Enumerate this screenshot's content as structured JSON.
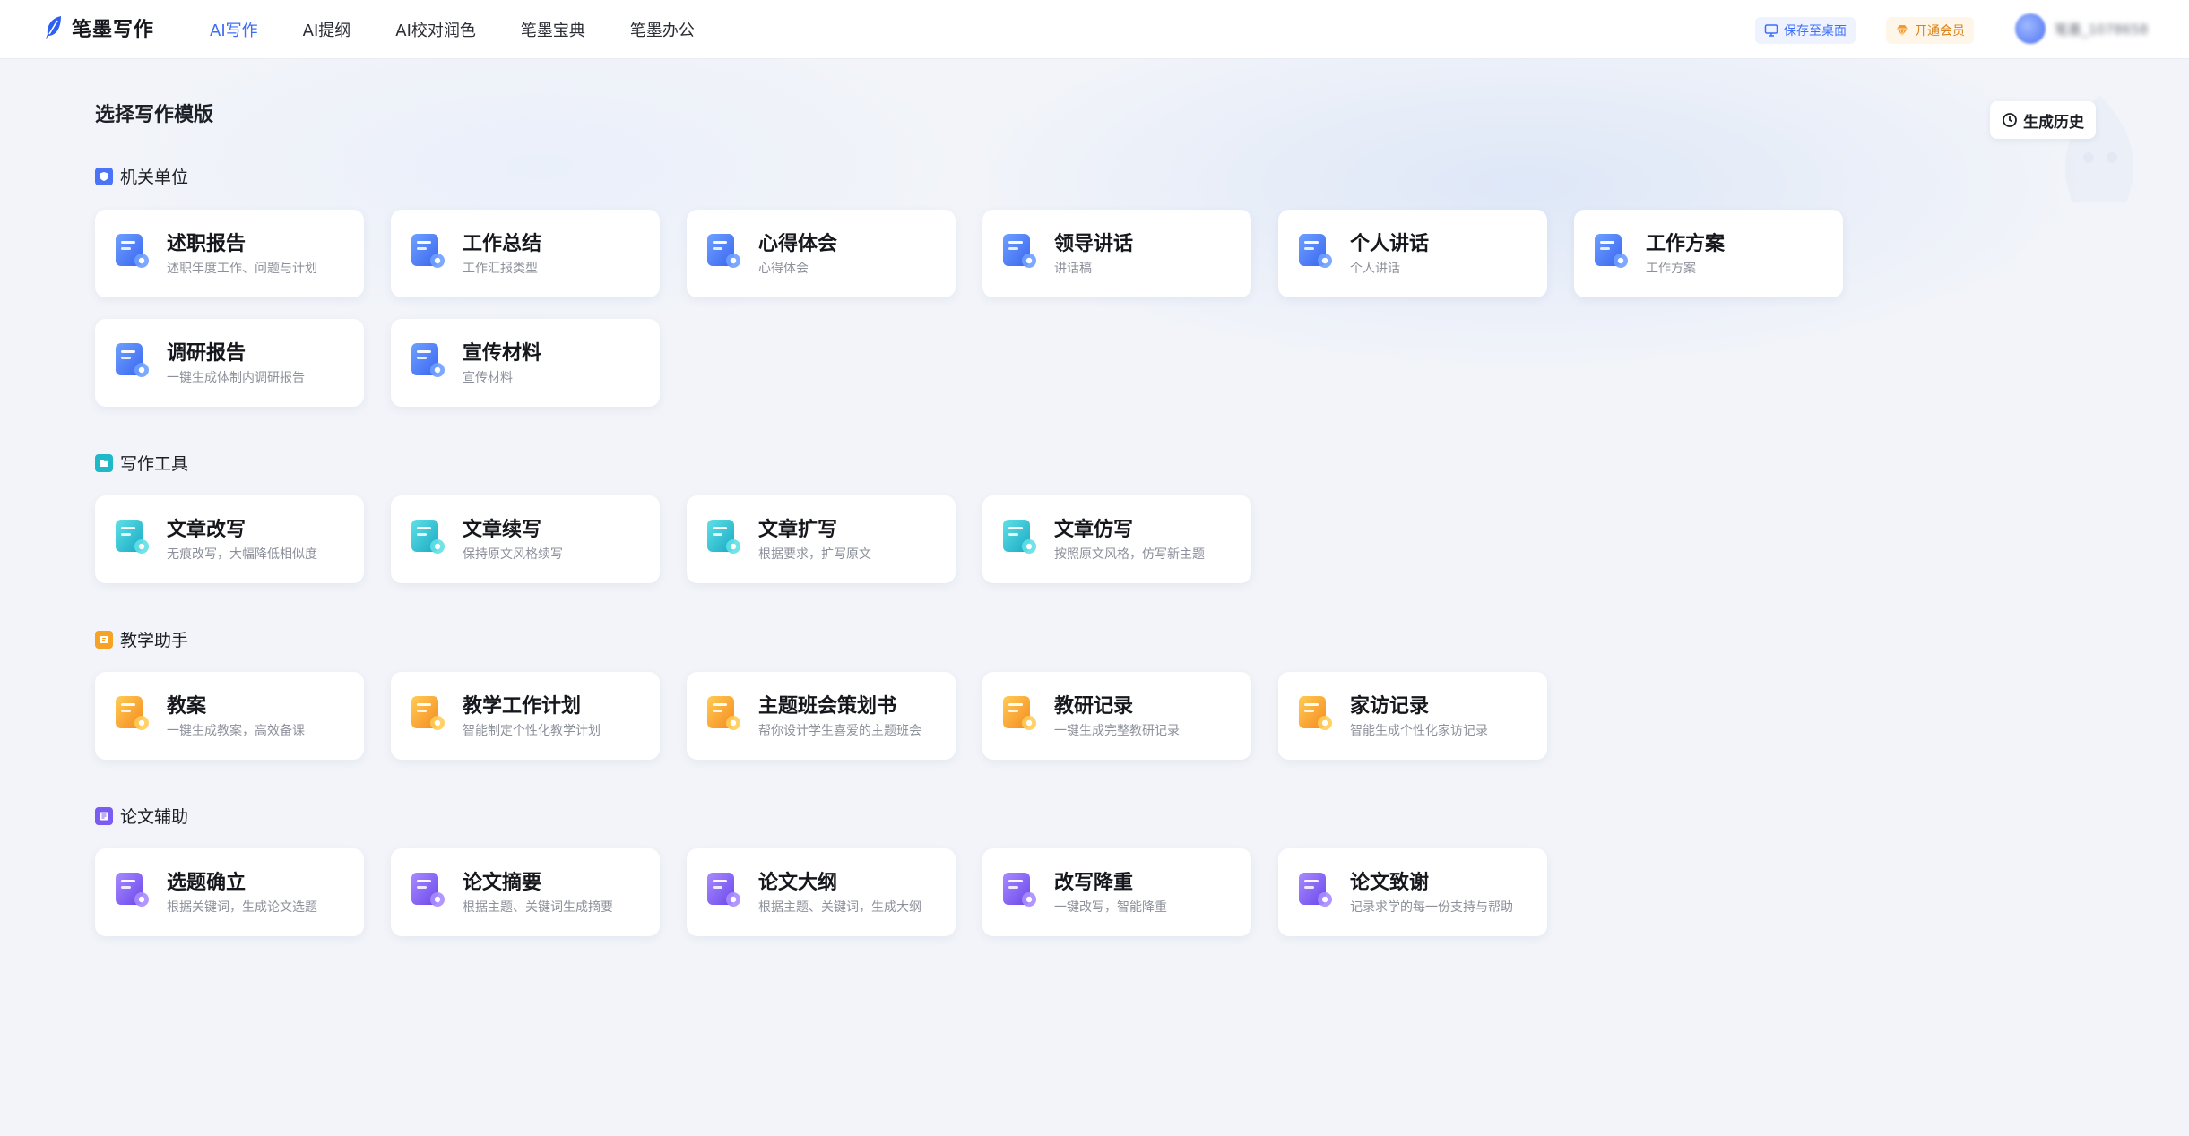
{
  "header": {
    "brand": "笔墨写作",
    "nav": [
      "AI写作",
      "AI提纲",
      "AI校对润色",
      "笔墨宝典",
      "笔墨办公"
    ],
    "active_nav": "AI写作",
    "save_label": "保存至桌面",
    "vip_label": "开通会员",
    "user_name": "笔墨_1078658"
  },
  "page": {
    "title": "选择写作模版",
    "history_label": "生成历史"
  },
  "sections": [
    {
      "title": "机关单位",
      "color": "#4a74f5",
      "cards": [
        {
          "title": "述职报告",
          "desc": "述职年度工作、问题与计划",
          "icon": "report-icon"
        },
        {
          "title": "工作总结",
          "desc": "工作汇报类型",
          "icon": "folder-check-icon"
        },
        {
          "title": "心得体会",
          "desc": "心得体会",
          "icon": "notes-star-icon"
        },
        {
          "title": "领导讲话",
          "desc": "讲话稿",
          "icon": "speech-doc-icon"
        },
        {
          "title": "个人讲话",
          "desc": "个人讲话",
          "icon": "person-chat-icon"
        },
        {
          "title": "工作方案",
          "desc": "工作方案",
          "icon": "folder-plan-icon"
        },
        {
          "title": "调研报告",
          "desc": "一键生成体制内调研报告",
          "icon": "clipboard-chart-icon"
        },
        {
          "title": "宣传材料",
          "desc": "宣传材料",
          "icon": "mail-check-icon"
        }
      ]
    },
    {
      "title": "写作工具",
      "color": "#1fb8c9",
      "cards": [
        {
          "title": "文章改写",
          "desc": "无痕改写，大幅降低相似度",
          "icon": "text-edit-icon"
        },
        {
          "title": "文章续写",
          "desc": "保持原文风格续写",
          "icon": "text-plus-icon"
        },
        {
          "title": "文章扩写",
          "desc": "根据要求，扩写原文",
          "icon": "text-expand-icon"
        },
        {
          "title": "文章仿写",
          "desc": "按照原文风格，仿写新主题",
          "icon": "text-copy-icon"
        }
      ]
    },
    {
      "title": "教学助手",
      "color": "#f6a224",
      "cards": [
        {
          "title": "教案",
          "desc": "一键生成教案，高效备课",
          "icon": "lesson-book-icon"
        },
        {
          "title": "教学工作计划",
          "desc": "智能制定个性化教学计划",
          "icon": "calendar-six-icon"
        },
        {
          "title": "主题班会策划书",
          "desc": "帮你设计学生喜爱的主题班会",
          "icon": "doc-lines-icon"
        },
        {
          "title": "教研记录",
          "desc": "一键生成完整教研记录",
          "icon": "graduation-cap-icon"
        },
        {
          "title": "家访记录",
          "desc": "智能生成个性化家访记录",
          "icon": "notebook-pen-icon"
        }
      ]
    },
    {
      "title": "论文辅助",
      "color": "#7b5cf0",
      "cards": [
        {
          "title": "选题确立",
          "desc": "根据关键词，生成论文选题",
          "icon": "topic-check-icon"
        },
        {
          "title": "论文摘要",
          "desc": "根据主题、关键词生成摘要",
          "icon": "abstract-quote-icon"
        },
        {
          "title": "论文大纲",
          "desc": "根据主题、关键词，生成大纲",
          "icon": "outline-tree-icon"
        },
        {
          "title": "改写降重",
          "desc": "一键改写，智能降重",
          "icon": "rewrite-search-icon"
        },
        {
          "title": "论文致谢",
          "desc": "记录求学的每一份支持与帮助",
          "icon": "thanks-heart-icon"
        }
      ]
    }
  ]
}
